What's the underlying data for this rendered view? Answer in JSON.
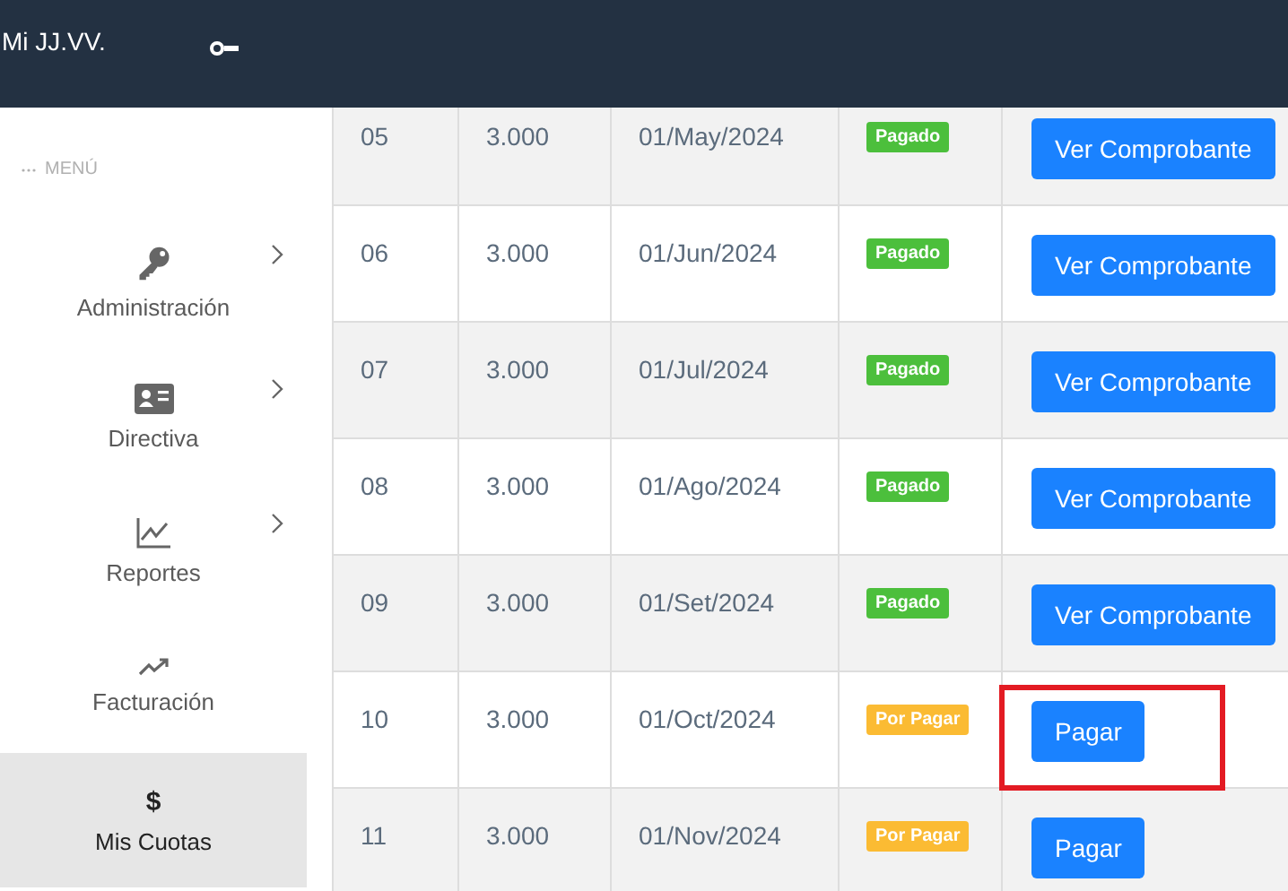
{
  "header": {
    "brand": "Mi JJ.VV."
  },
  "sidebar": {
    "section_label": "MENÚ",
    "items": [
      {
        "label": "Administración",
        "has_submenu": true,
        "selected": false
      },
      {
        "label": "Directiva",
        "has_submenu": true,
        "selected": false
      },
      {
        "label": "Reportes",
        "has_submenu": true,
        "selected": false
      },
      {
        "label": "Facturación",
        "has_submenu": false,
        "selected": false
      },
      {
        "label": "Mis Cuotas",
        "symbol": "$",
        "has_submenu": false,
        "selected": true
      }
    ]
  },
  "table": {
    "rows": [
      {
        "month": "05",
        "amount": "3.000",
        "date": "01/May/2024",
        "status": {
          "kind": "paid",
          "label": "Pagado"
        },
        "action": "Ver Comprobante",
        "highlighted": false
      },
      {
        "month": "06",
        "amount": "3.000",
        "date": "01/Jun/2024",
        "status": {
          "kind": "paid",
          "label": "Pagado"
        },
        "action": "Ver Comprobante",
        "highlighted": false
      },
      {
        "month": "07",
        "amount": "3.000",
        "date": "01/Jul/2024",
        "status": {
          "kind": "paid",
          "label": "Pagado"
        },
        "action": "Ver Comprobante",
        "highlighted": false
      },
      {
        "month": "08",
        "amount": "3.000",
        "date": "01/Ago/2024",
        "status": {
          "kind": "paid",
          "label": "Pagado"
        },
        "action": "Ver Comprobante",
        "highlighted": false
      },
      {
        "month": "09",
        "amount": "3.000",
        "date": "01/Set/2024",
        "status": {
          "kind": "paid",
          "label": "Pagado"
        },
        "action": "Ver Comprobante",
        "highlighted": false
      },
      {
        "month": "10",
        "amount": "3.000",
        "date": "01/Oct/2024",
        "status": {
          "kind": "pending",
          "label": "Por Pagar"
        },
        "action": "Pagar",
        "highlighted": true
      },
      {
        "month": "11",
        "amount": "3.000",
        "date": "01/Nov/2024",
        "status": {
          "kind": "pending",
          "label": "Por Pagar"
        },
        "action": "Pagar",
        "highlighted": false
      }
    ]
  }
}
